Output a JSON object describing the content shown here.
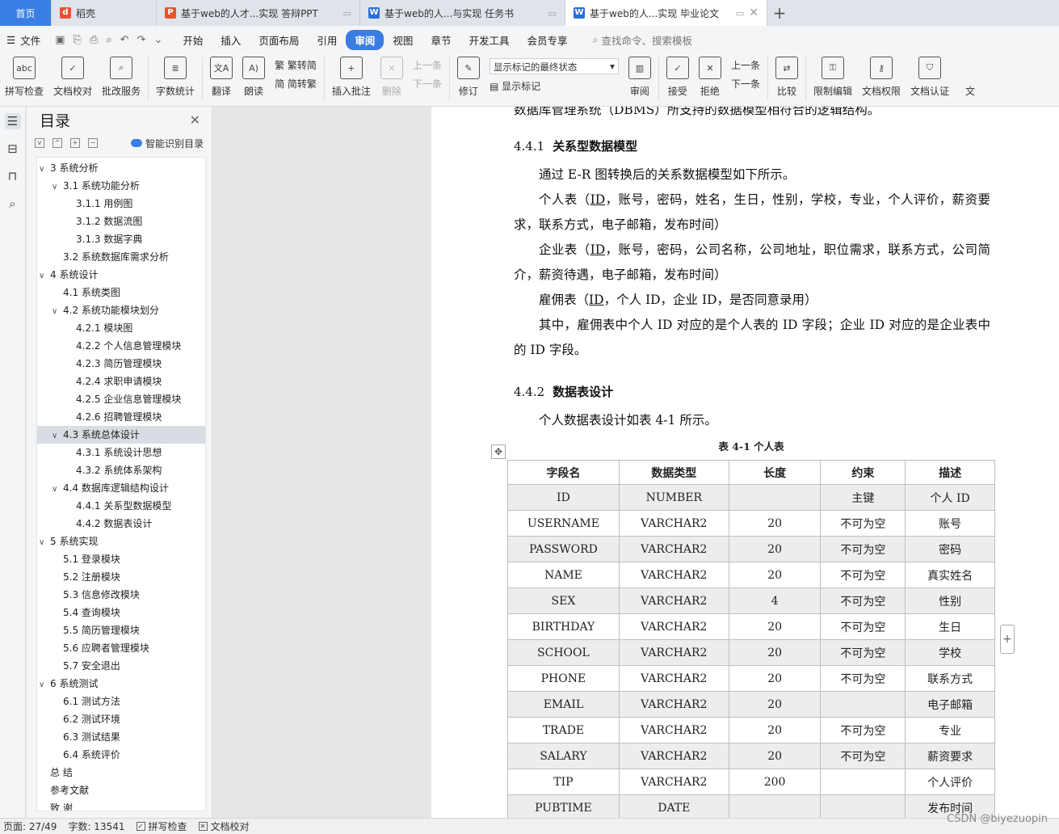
{
  "tabs": [
    {
      "label": "首页",
      "icon": "home"
    },
    {
      "label": "稻壳",
      "icon": "docer-icon",
      "color": "#e8503a"
    },
    {
      "label": "基于web的人才...实现 答辩PPT",
      "icon": "ppt-icon",
      "color": "#e2552b"
    },
    {
      "label": "基于web的人...与实现 任务书",
      "icon": "word-icon",
      "color": "#2b6fd6"
    },
    {
      "label": "基于web的人...实现 毕业论文",
      "icon": "word-icon",
      "color": "#2b6fd6"
    }
  ],
  "menu": {
    "file": "文件",
    "items": [
      "开始",
      "插入",
      "页面布局",
      "引用",
      "审阅",
      "视图",
      "章节",
      "开发工具",
      "会员专享"
    ],
    "active": "审阅",
    "search": "查找命令、搜索模板"
  },
  "ribbon": {
    "spell": "拼写检查",
    "proof": "文档校对",
    "batch": "批改服务",
    "wordcount": "字数统计",
    "translate": "翻译",
    "read": "朗读",
    "trad": "繁转简",
    "simp": "简转繁",
    "insert_comment": "插入批注",
    "delete": "删除",
    "prev": "上一条",
    "next": "下一条",
    "revise": "修订",
    "markup_select": "显示标记的最终状态",
    "show_markup": "显示标记",
    "review": "审阅",
    "accept": "接受",
    "reject": "拒绝",
    "prev2": "上一条",
    "next2": "下一条",
    "compare": "比较",
    "restrict": "限制编辑",
    "rights": "文档权限",
    "cert": "文档认证",
    "more": "文"
  },
  "toc": {
    "title": "目录",
    "smart": "智能识别目录",
    "items": [
      {
        "label": "3  系统分析",
        "level": 1,
        "exp": true
      },
      {
        "label": "3.1  系统功能分析",
        "level": 2,
        "exp": true
      },
      {
        "label": "3.1.1  用例图",
        "level": 3
      },
      {
        "label": "3.1.2  数据流图",
        "level": 3
      },
      {
        "label": "3.1.3  数据字典",
        "level": 3
      },
      {
        "label": "3.2  系统数据库需求分析",
        "level": 2
      },
      {
        "label": "4  系统设计",
        "level": 1,
        "exp": true
      },
      {
        "label": "4.1 系统类图",
        "level": 2
      },
      {
        "label": "4.2 系统功能模块划分",
        "level": 2,
        "exp": true
      },
      {
        "label": "4.2.1  模块图",
        "level": 3
      },
      {
        "label": "4.2.2  个人信息管理模块",
        "level": 3
      },
      {
        "label": "4.2.3  简历管理模块",
        "level": 3
      },
      {
        "label": "4.2.4  求职申请模块",
        "level": 3
      },
      {
        "label": "4.2.5  企业信息管理模块",
        "level": 3
      },
      {
        "label": "4.2.6  招聘管理模块",
        "level": 3
      },
      {
        "label": "4.3 系统总体设计",
        "level": 2,
        "exp": true,
        "sel": true
      },
      {
        "label": "4.3.1  系统设计思想",
        "level": 3
      },
      {
        "label": "4.3.2  系统体系架构",
        "level": 3
      },
      {
        "label": "4.4  数据库逻辑结构设计",
        "level": 2,
        "exp": true
      },
      {
        "label": "4.4.1  关系型数据模型",
        "level": 3
      },
      {
        "label": "4.4.2  数据表设计",
        "level": 3
      },
      {
        "label": "5  系统实现",
        "level": 1,
        "exp": true
      },
      {
        "label": "5.1  登录模块",
        "level": 2
      },
      {
        "label": "5.2  注册模块",
        "level": 2
      },
      {
        "label": "5.3  信息修改模块",
        "level": 2
      },
      {
        "label": "5.4  查询模块",
        "level": 2
      },
      {
        "label": "5.5  简历管理模块",
        "level": 2
      },
      {
        "label": "5.6  应聘者管理模块",
        "level": 2
      },
      {
        "label": "5.7  安全退出",
        "level": 2
      },
      {
        "label": "6  系统测试",
        "level": 1,
        "exp": true
      },
      {
        "label": "6.1  测试方法",
        "level": 2
      },
      {
        "label": "6.2 测试环境",
        "level": 2
      },
      {
        "label": "6.3  测试结果",
        "level": 2
      },
      {
        "label": "6.4 系统评价",
        "level": 2
      },
      {
        "label": "总    结",
        "level": 1
      },
      {
        "label": "参考文献",
        "level": 1
      },
      {
        "label": "致  谢",
        "level": 1
      }
    ]
  },
  "doc": {
    "cut_line": "数据库管理系统（DBMS）所支持的数据模型相符合的逻辑结构。",
    "h441_num": "4.4.1",
    "h441_text": "关系型数据模型",
    "p1": "通过 E-R 图转换后的关系数据模型如下所示。",
    "p2_pre": "个人表（",
    "p2_id": "ID",
    "p2_post": "，账号，密码，姓名，生日，性别，学校，专业，个人评价，薪资要求，联系方式，电子邮箱，发布时间）",
    "p3_pre": "企业表（",
    "p3_id": "ID",
    "p3_post": "，账号，密码，公司名称，公司地址，职位需求，联系方式，公司简介，薪资待遇，电子邮箱，发布时间）",
    "p4_pre": "雇佣表（",
    "p4_id": "ID",
    "p4_post": "，个人 ID，企业 ID，是否同意录用）",
    "p5": "其中，雇佣表中个人 ID 对应的是个人表的 ID 字段；企业 ID 对应的是企业表中的 ID 字段。",
    "h442_num": "4.4.2",
    "h442_text": "数据表设计",
    "p6": "个人数据表设计如表 4-1 所示。",
    "table_caption": "表 4-1  个人表",
    "table": {
      "headers": [
        "字段名",
        "数据类型",
        "长度",
        "约束",
        "描述"
      ],
      "rows": [
        [
          "ID",
          "NUMBER",
          "",
          "主键",
          "个人 ID"
        ],
        [
          "USERNAME",
          "VARCHAR2",
          "20",
          "不可为空",
          "账号"
        ],
        [
          "PASSWORD",
          "VARCHAR2",
          "20",
          "不可为空",
          "密码"
        ],
        [
          "NAME",
          "VARCHAR2",
          "20",
          "不可为空",
          "真实姓名"
        ],
        [
          "SEX",
          "VARCHAR2",
          "4",
          "不可为空",
          "性别"
        ],
        [
          "BIRTHDAY",
          "VARCHAR2",
          "20",
          "不可为空",
          "生日"
        ],
        [
          "SCHOOL",
          "VARCHAR2",
          "20",
          "不可为空",
          "学校"
        ],
        [
          "PHONE",
          "VARCHAR2",
          "20",
          "不可为空",
          "联系方式"
        ],
        [
          "EMAIL",
          "VARCHAR2",
          "20",
          "",
          "电子邮箱"
        ],
        [
          "TRADE",
          "VARCHAR2",
          "20",
          "不可为空",
          "专业"
        ],
        [
          "SALARY",
          "VARCHAR2",
          "20",
          "不可为空",
          "薪资要求"
        ],
        [
          "TIP",
          "VARCHAR2",
          "200",
          "",
          "个人评价"
        ],
        [
          "PUBTIME",
          "DATE",
          "",
          "",
          "发布时间"
        ]
      ]
    }
  },
  "status": {
    "page": "页面: 27/49",
    "words": "字数: 13541",
    "spell": "拼写检查",
    "proof": "文档校对",
    "watermark": "CSDN @biyezuopin"
  }
}
